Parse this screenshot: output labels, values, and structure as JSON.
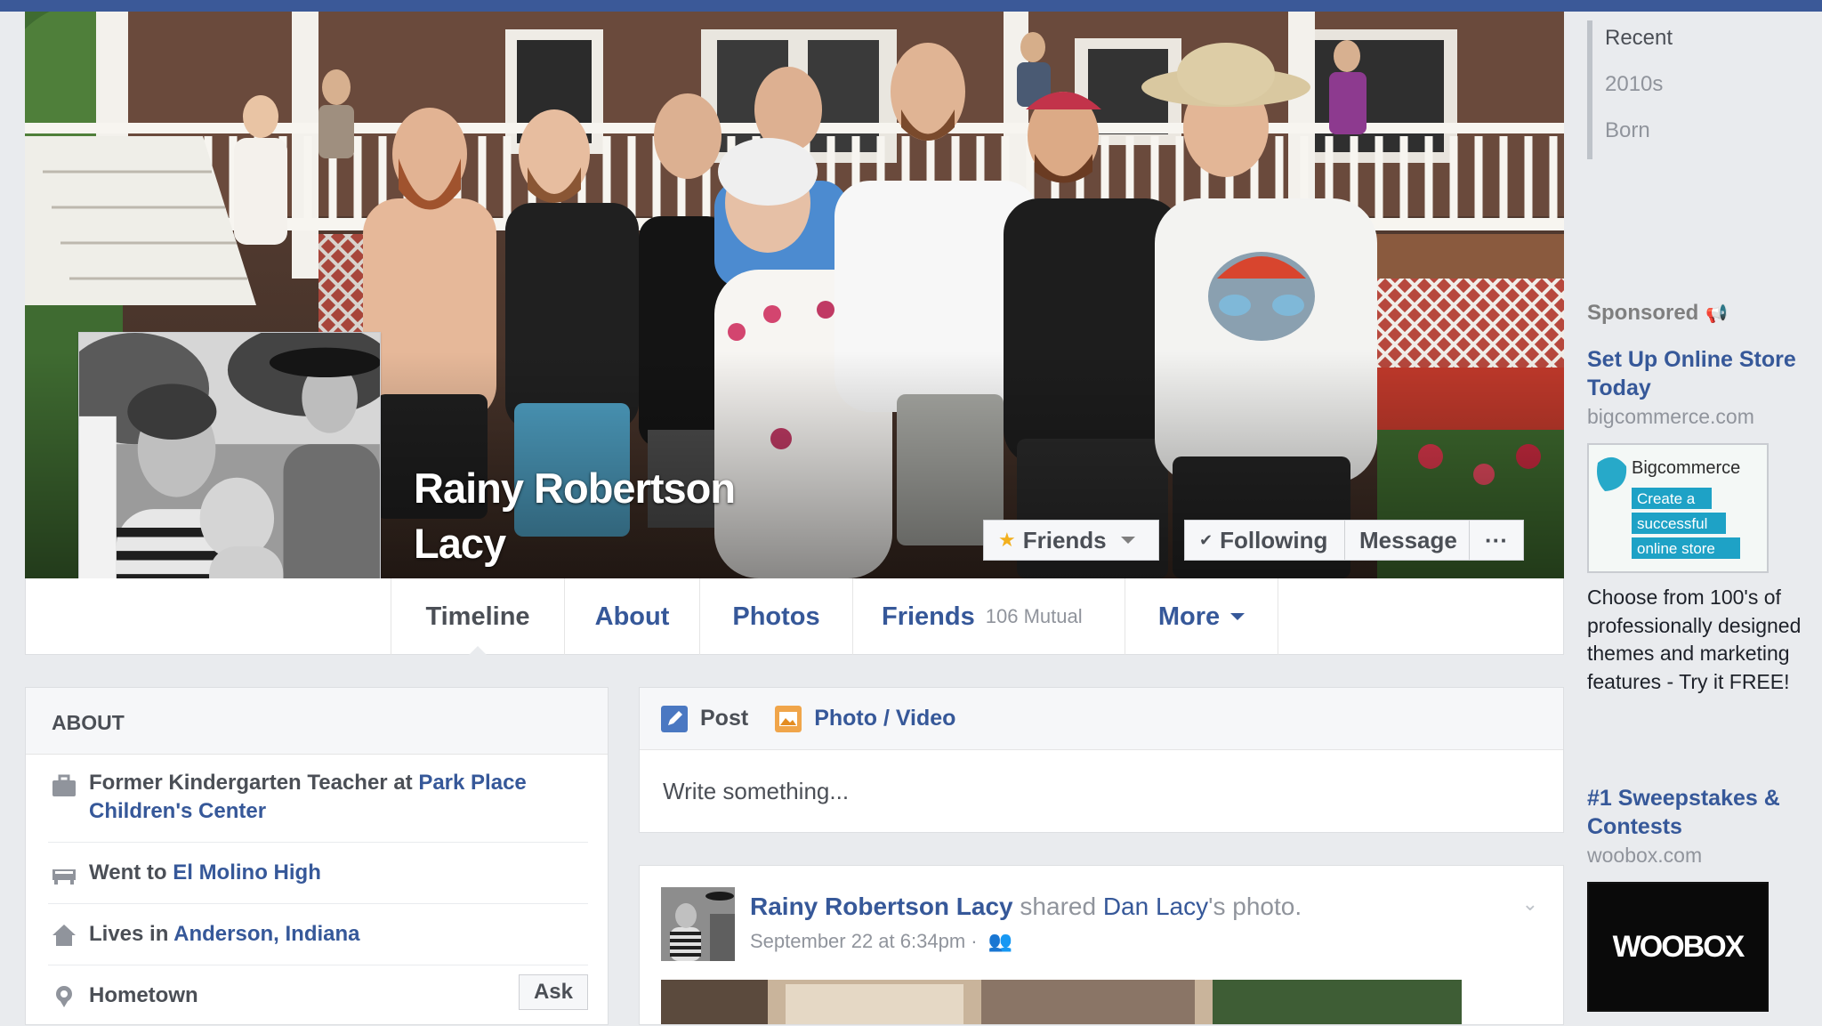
{
  "profile": {
    "name_line1": "Rainy Robertson",
    "name_line2": "Lacy"
  },
  "cover_actions": {
    "friends": "Friends",
    "following": "Following",
    "message": "Message",
    "more": "···"
  },
  "tabs": [
    {
      "label": "Timeline",
      "active": true
    },
    {
      "label": "About"
    },
    {
      "label": "Photos"
    },
    {
      "label": "Friends",
      "sub": "106 Mutual"
    },
    {
      "label": "More"
    }
  ],
  "years": [
    "Recent",
    "2010s",
    "Born"
  ],
  "sponsored": "Sponsored",
  "ads": [
    {
      "title": "Set Up Online Store Today",
      "domain": "bigcommerce.com",
      "image": {
        "brand": "Bigcommerce",
        "lines": [
          "Create a",
          "successful",
          "online store"
        ]
      },
      "body": "Choose from 100's of professionally designed themes and marketing features - Try it FREE!"
    },
    {
      "title": "#1 Sweepstakes & Contests",
      "domain": "woobox.com",
      "image": {
        "brand": "WOOBOX"
      }
    }
  ],
  "about": {
    "heading": "ABOUT",
    "work_prefix": "Former Kindergarten Teacher at",
    "work_place": "Park Place Children's Center",
    "school_prefix": "Went to",
    "school": "El Molino High",
    "lives_prefix": "Lives in",
    "lives": "Anderson, Indiana",
    "hometown": "Hometown",
    "ask": "Ask"
  },
  "composer": {
    "post": "Post",
    "photo_video": "Photo / Video",
    "placeholder": "Write something..."
  },
  "story": {
    "author": "Rainy Robertson Lacy",
    "verb": "shared",
    "target": "Dan Lacy",
    "suffix": "'s photo.",
    "date": "September 22 at 6:34pm ·"
  },
  "colors": {
    "brand": "#3b5998",
    "link": "#365899",
    "muted": "#90949c",
    "background": "#e9ebee"
  }
}
